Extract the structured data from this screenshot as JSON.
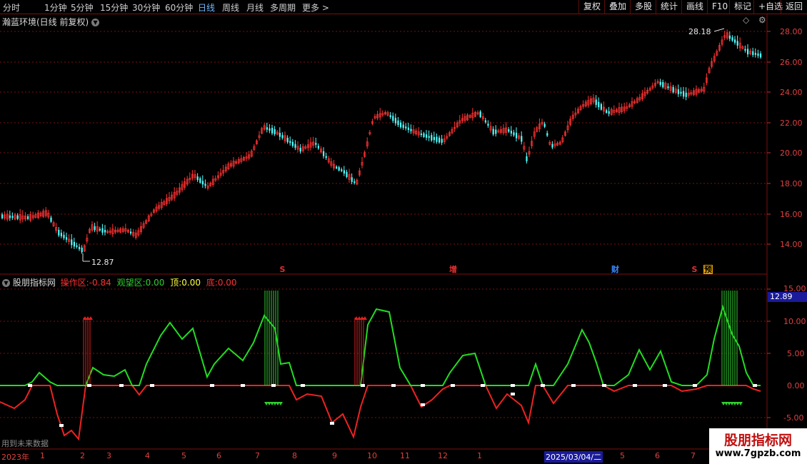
{
  "toolbar": {
    "periods": [
      "分时",
      "1分钟",
      "5分钟",
      "15分钟",
      "30分钟",
      "60分钟",
      "日线",
      "周线",
      "月线",
      "多周期",
      "更多"
    ],
    "active_period": "日线",
    "more_arrow": ">",
    "buttons": [
      "复权",
      "叠加",
      "多股",
      "统计",
      "画线",
      "F10",
      "标记",
      "+自选",
      "返回"
    ]
  },
  "main_panel": {
    "title": "瀚蓝环境(日线 前复权)",
    "price_axis": [
      "28.00",
      "26.00",
      "24.00",
      "22.00",
      "20.00",
      "18.00",
      "16.00",
      "14.00"
    ],
    "high_label": "28.18",
    "low_label": "12.87",
    "event_markers": [
      {
        "text": "S",
        "color": "#e03030"
      },
      {
        "text": "增",
        "color": "#e03030"
      },
      {
        "text": "财",
        "color": "#3a8cff"
      },
      {
        "text": "S",
        "color": "#e03030"
      },
      {
        "text": "预",
        "color": "#e0a000"
      }
    ]
  },
  "indicator_panel": {
    "name": "股朋指标网",
    "fields": [
      {
        "label": "操作区:",
        "value": "-0.84",
        "color": "#ff3030"
      },
      {
        "label": "观望区:",
        "value": "0.00",
        "color": "#30d030"
      },
      {
        "label": "顶:",
        "value": "0.00",
        "color": "#ffff40"
      },
      {
        "label": "底:",
        "value": "0.00",
        "color": "#ff3030"
      }
    ],
    "axis": [
      "15.00",
      "10.00",
      "5.00",
      "0.00",
      "-5.00"
    ],
    "current_value": "12.89",
    "future_data_note": "用到未来数据"
  },
  "date_axis": {
    "ticks": [
      "2023年",
      "1",
      "2",
      "3",
      "4",
      "5",
      "6",
      "7",
      "8",
      "9",
      "10",
      "11",
      "12",
      "1",
      "2025/03/04/二",
      "5",
      "6",
      "7"
    ]
  },
  "watermark": {
    "title": "股朋指标网",
    "url": "www.7gpzb.com"
  },
  "colors": {
    "up": "#ff3232",
    "down": "#54ffff",
    "grid": "#7a1010",
    "positive_line": "#22dd22",
    "negative_line": "#ee2222"
  }
}
